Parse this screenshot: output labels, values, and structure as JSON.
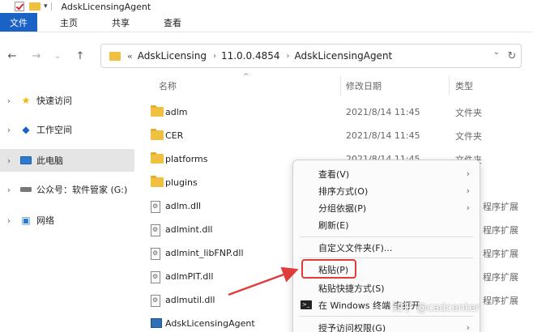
{
  "window": {
    "title": "AdskLicensingAgent"
  },
  "ribbon": {
    "tabs": [
      "文件",
      "主页",
      "共享",
      "查看"
    ]
  },
  "address": {
    "crumbs": [
      "AdskLicensing",
      "11.0.0.4854",
      "AdskLicensingAgent"
    ],
    "overflow_glyph": "«"
  },
  "sidebar": {
    "items": [
      {
        "label": "快速访问",
        "icon": "star-icon"
      },
      {
        "label": "工作空间",
        "icon": "cloud-icon"
      },
      {
        "label": "此电脑",
        "icon": "pc-icon"
      },
      {
        "label": "公众号：软件管家 (G:)",
        "icon": "drive-icon"
      },
      {
        "label": "网络",
        "icon": "network-icon"
      }
    ]
  },
  "filelist": {
    "columns": {
      "name": "名称",
      "date": "修改日期",
      "type": "类型"
    },
    "rows": [
      {
        "name": "adlm",
        "kind": "folder",
        "date": "2021/8/14 11:45",
        "type": "文件夹"
      },
      {
        "name": "CER",
        "kind": "folder",
        "date": "2021/8/14 11:45",
        "type": "文件夹"
      },
      {
        "name": "platforms",
        "kind": "folder",
        "date": "2021/8/14 11:45",
        "type": "文件夹"
      },
      {
        "name": "plugins",
        "kind": "folder",
        "date": "",
        "type": ""
      },
      {
        "name": "adlm.dll",
        "kind": "dll",
        "date": "",
        "type": "程序扩展"
      },
      {
        "name": "adlmint.dll",
        "kind": "dll",
        "date": "",
        "type": "程序扩展"
      },
      {
        "name": "adlmint_libFNP.dll",
        "kind": "dll",
        "date": "",
        "type": "程序扩展"
      },
      {
        "name": "adlmPIT.dll",
        "kind": "dll",
        "date": "",
        "type": "程序扩展"
      },
      {
        "name": "adlmutil.dll",
        "kind": "dll",
        "date": "",
        "type": "程序扩展"
      },
      {
        "name": "AdskLicensingAgent",
        "kind": "exe",
        "date": "",
        "type": ""
      }
    ]
  },
  "context_menu": {
    "items": [
      {
        "label": "查看(V)",
        "submenu": true
      },
      {
        "label": "排序方式(O)",
        "submenu": true
      },
      {
        "label": "分组依据(P)",
        "submenu": true
      },
      {
        "label": "刷新(E)",
        "submenu": false
      },
      {
        "label": "自定义文件夹(F)...",
        "submenu": false
      },
      {
        "label": "粘贴(P)",
        "submenu": false,
        "highlighted": true
      },
      {
        "label": "粘贴快捷方式(S)",
        "submenu": false
      },
      {
        "label": "在 Windows 终端 中打开",
        "submenu": false
      },
      {
        "label": "授予访问权限(G)",
        "submenu": true
      }
    ]
  },
  "annotation": {
    "highlight_color": "#e03c3c"
  },
  "watermark": "知乎 @cadcenter",
  "colors": {
    "accent": "#1a62c5",
    "folder": "#f0c040"
  }
}
